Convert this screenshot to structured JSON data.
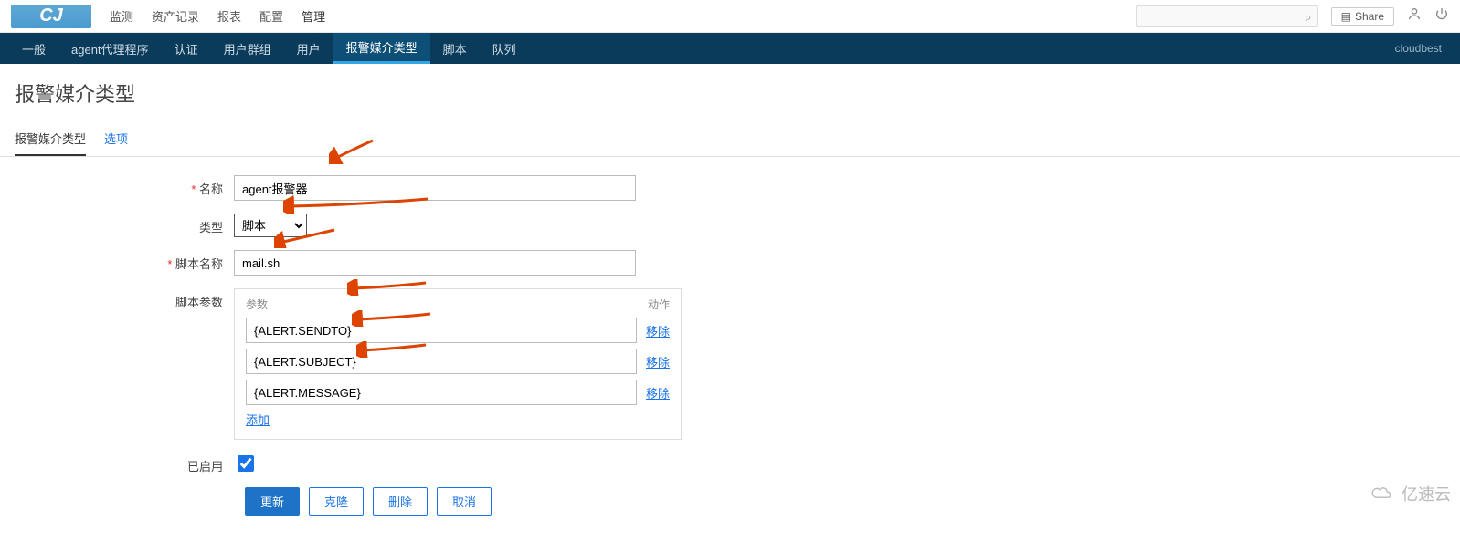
{
  "header": {
    "logo_text": "CJ",
    "nav": [
      "监测",
      "资产记录",
      "报表",
      "配置",
      "管理"
    ],
    "active_nav_index": 4,
    "share_label": "Share",
    "search_placeholder": ""
  },
  "subnav": {
    "items": [
      "一般",
      "agent代理程序",
      "认证",
      "用户群组",
      "用户",
      "报警媒介类型",
      "脚本",
      "队列"
    ],
    "active_index": 5,
    "right_text": "cloudbest"
  },
  "page": {
    "title": "报警媒介类型",
    "tabs": [
      "报警媒介类型",
      "选项"
    ],
    "active_tab_index": 0
  },
  "form": {
    "name_label": "名称",
    "name_value": "agent报警器",
    "type_label": "类型",
    "type_value": "脚本",
    "script_name_label": "脚本名称",
    "script_name_value": "mail.sh",
    "params_label": "脚本参数",
    "params_header_left": "参数",
    "params_header_right": "动作",
    "params": [
      "{ALERT.SENDTO}",
      "{ALERT.SUBJECT}",
      "{ALERT.MESSAGE}"
    ],
    "remove_label": "移除",
    "add_label": "添加",
    "enabled_label": "已启用",
    "enabled_checked": true,
    "buttons": {
      "update": "更新",
      "clone": "克隆",
      "delete": "删除",
      "cancel": "取消"
    }
  },
  "watermark": "亿速云"
}
